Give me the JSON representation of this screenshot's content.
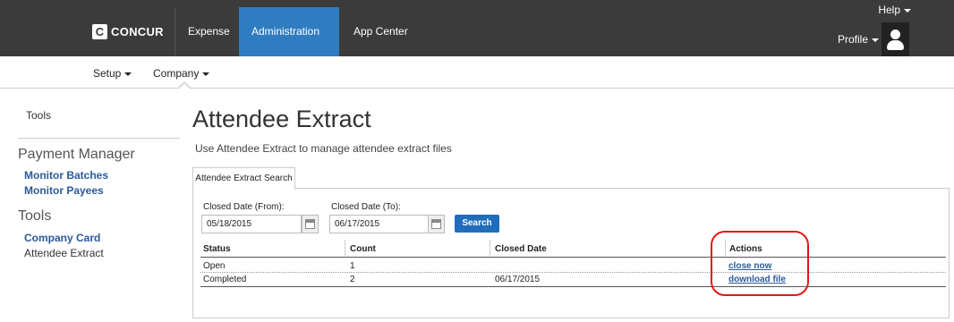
{
  "topbar": {
    "logo_letter": "C",
    "logo_text": "CONCUR",
    "nav": [
      {
        "label": "Expense"
      },
      {
        "label": "Administration"
      },
      {
        "label": "App Center"
      }
    ],
    "help_label": "Help",
    "profile_label": "Profile",
    "active_color": "#2f7cc0"
  },
  "subnav": {
    "items": [
      {
        "label": "Setup"
      },
      {
        "label": "Company"
      }
    ]
  },
  "sidebar": {
    "tools_top": "Tools",
    "payment_manager_heading": "Payment Manager",
    "payment_links": [
      "Monitor Batches",
      "Monitor Payees"
    ],
    "tools_heading": "Tools",
    "tools_links": [
      "Company Card"
    ],
    "current_page": "Attendee Extract"
  },
  "main": {
    "title": "Attendee Extract",
    "description": "Use Attendee Extract to manage attendee extract files",
    "tab_label": "Attendee Extract Search",
    "from_label": "Closed Date (From):",
    "from_value": "05/18/2015",
    "to_label": "Closed Date (To):",
    "to_value": "06/17/2015",
    "search_label": "Search",
    "table": {
      "headers": [
        "Status",
        "Count",
        "Closed Date",
        "Actions"
      ],
      "rows": [
        {
          "status": "Open",
          "count": "1",
          "closed_date": "",
          "action": "close now"
        },
        {
          "status": "Completed",
          "count": "2",
          "closed_date": "06/17/2015",
          "action": "download file"
        }
      ]
    }
  },
  "colors": {
    "topbar": "#3b3b3b",
    "link": "#2a5a9a",
    "search_button": "#1f6dbb",
    "highlight": "#e01818"
  }
}
